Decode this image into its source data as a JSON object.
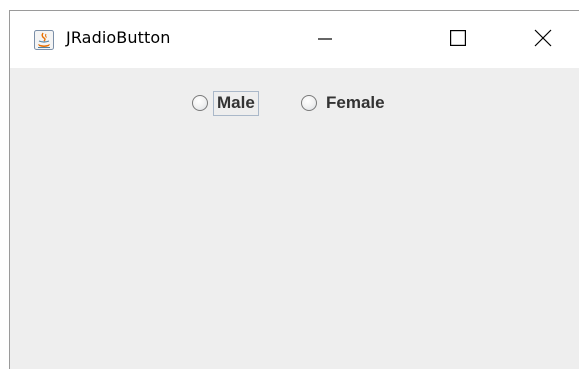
{
  "window": {
    "title": "JRadioButton",
    "icon": "java-coffee-icon"
  },
  "title_controls": {
    "minimize_icon": "minimize-icon",
    "maximize_icon": "maximize-icon",
    "close_icon": "close-icon"
  },
  "radios": [
    {
      "label": "Male",
      "selected": false,
      "focused": true
    },
    {
      "label": "Female",
      "selected": false,
      "focused": false
    }
  ],
  "colors": {
    "titlebar": "#ffffff",
    "content_background": "#eeeeee",
    "label_text": "#333333",
    "focus_border": "#aab8c9"
  }
}
